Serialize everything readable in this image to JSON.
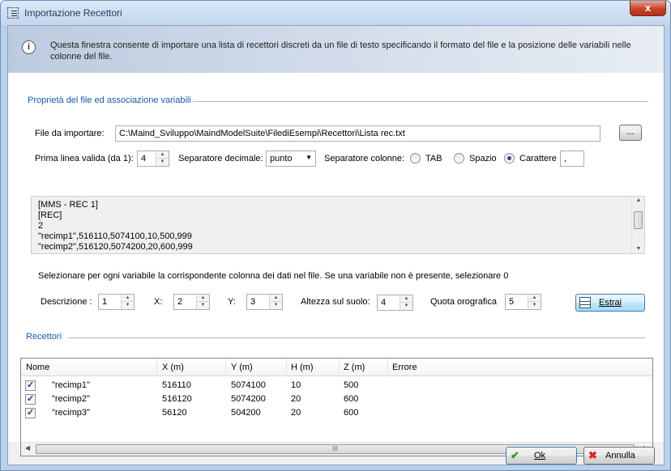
{
  "window": {
    "title": "Importazione Recettori",
    "close_label": "x"
  },
  "info": {
    "icon": "info-icon",
    "text": "Questa finestra consente di importare una lista di recettori discreti da un file di testo specificando il formato del file e la posizione delle variabili nelle colonne del file."
  },
  "file_group": {
    "title": "Proprietà del file ed associazione variabili",
    "file_label": "File da importare:",
    "file_path": "C:\\Maind_Sviluppo\\MaindModelSuite\\FilediEsempi\\Recettori\\Lista rec.txt",
    "browse_label": "...",
    "first_line_label": "Prima linea valida (da 1):",
    "first_line_value": "4",
    "decimal_sep_label": "Separatore decimale:",
    "decimal_sep_value": "punto",
    "col_sep_label": "Separatore colonne:",
    "radio_tab": "TAB",
    "radio_space": "Spazio",
    "radio_char": "Carattere",
    "selected_radio": "Carattere",
    "char_value": ","
  },
  "preview": {
    "lines": [
      "[MMS - REC 1]",
      "[REC]",
      "2",
      "\"recimp1\",516110,5074100,10,500,999",
      "\"recimp2\",516120,5074200,20,600,999"
    ]
  },
  "mapping": {
    "instruction": "Selezionare per ogni variabile la corrispondente colonna dei dati nel file. Se una variabile non è presente, selezionare 0",
    "desc_label": "Descrizione :",
    "desc_value": "1",
    "x_label": "X:",
    "x_value": "2",
    "y_label": "Y:",
    "y_value": "3",
    "height_label": "Altezza sul suolo:",
    "height_value": "4",
    "quota_label": "Quota orografica",
    "quota_value": "5",
    "extract_label": "Estrai"
  },
  "receivers": {
    "title": "Recettori",
    "columns": [
      "Nome",
      "X (m)",
      "Y (m)",
      "H (m)",
      "Z (m)",
      "Errore"
    ],
    "rows": [
      {
        "checked": true,
        "name": "\"recimp1\"",
        "x": "516110",
        "y": "5074100",
        "h": "10",
        "z": "500",
        "err": ""
      },
      {
        "checked": true,
        "name": "\"recimp2\"",
        "x": "516120",
        "y": "5074200",
        "h": "20",
        "z": "600",
        "err": ""
      },
      {
        "checked": true,
        "name": "\"recimp3\"",
        "x": "56120",
        "y": "504200",
        "h": "20",
        "z": "600",
        "err": ""
      }
    ],
    "hscroll_grip": "III"
  },
  "footer": {
    "ok_label": "Ok",
    "cancel_label": "Annulla"
  },
  "colors": {
    "accent": "#1c5aa8",
    "window_frame": "#b9d1ea",
    "banner": "#bccbe0"
  }
}
